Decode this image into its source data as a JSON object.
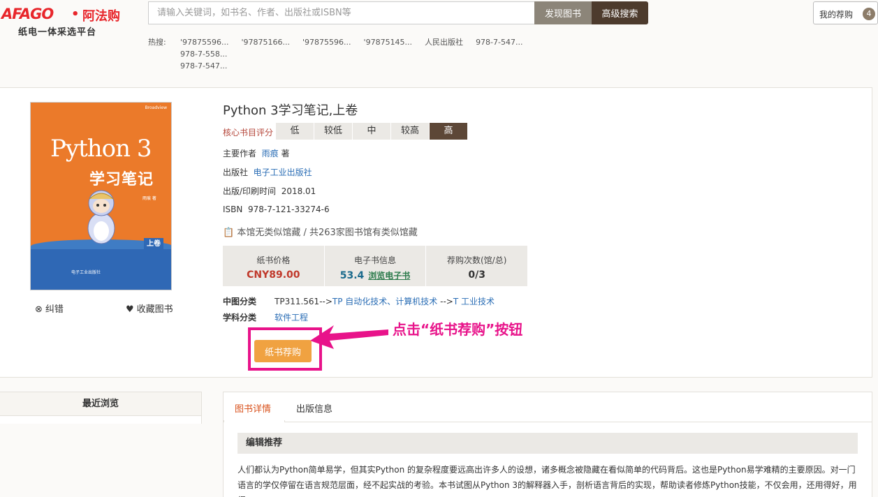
{
  "header": {
    "logo_mark": "AFAGO",
    "logo_name": "阿法购",
    "logo_slogan": "纸电一体采选平台",
    "search_placeholder": "请输入关键词，如书名、作者、出版社或ISBN等",
    "discover_label": "发现图书",
    "advanced_label": "高级搜索",
    "cart_label": "我的荐购",
    "cart_count": "4"
  },
  "hot_search": {
    "label": "热搜:",
    "items": [
      "'97875596...",
      "'97875166...",
      "'97875596...",
      "'97875145...",
      "人民出版社",
      "978-7-547...",
      "978-7-558...",
      "978-7-547..."
    ]
  },
  "book": {
    "title": "Python 3学习笔记,上卷",
    "score_label": "核心书目评分",
    "score_levels": [
      "低",
      "较低",
      "中",
      "较高",
      "高"
    ],
    "active_score": 4,
    "author_label": "主要作者",
    "author": "雨痕",
    "author_suffix": "著",
    "publisher_label": "出版社",
    "publisher": "电子工业出版社",
    "pubdate_label": "出版/印刷时间",
    "pubdate": "2018.01",
    "isbn_label": "ISBN",
    "isbn": "978-7-121-33274-6",
    "holdings": "本馆无类似馆藏 / 共263家图书馆有类似馆藏",
    "cover": {
      "title": "Python 3",
      "subtitle": "学习笔记",
      "volume": "上卷"
    }
  },
  "stats": {
    "paper_price_label": "纸书价格",
    "paper_price": "CNY89.00",
    "ebook_label": "电子书信息",
    "ebook_value": "53.4",
    "ebook_link": "浏览电子书",
    "recommend_label": "荐购次数(馆/总)",
    "recommend_value": "0/3"
  },
  "classification": {
    "clc_label": "中图分类",
    "clc_code": "TP311.561-->",
    "clc_path1": "TP 自动化技术、计算机技术",
    "clc_sep": "-->",
    "clc_path2": "T 工业技术",
    "subject_label": "学科分类",
    "subject": "软件工程"
  },
  "actions": {
    "correct": "纠错",
    "favorite": "收藏图书",
    "recommend_paper": "纸书荐购"
  },
  "annotation": {
    "callout": "点击“纸书荐购”按钮",
    "color": "#e8138a"
  },
  "recent": {
    "title": "最近浏览"
  },
  "details": {
    "tabs": [
      "图书详情",
      "出版信息"
    ],
    "section_title": "编辑推荐",
    "paragraph": "人们都认为Python简单易学，但其实Python 的复杂程度要远高出许多人的设想，诸多概念被隐藏在看似简单的代码背后。这也是Python易学难精的主要原因。对一门语言的学仅停留在语言规范层面，经不起实战的考验。本书试图从Python 3的解释器入手，剖析语言背后的实现，帮助读者修炼Python技能，不仅会用，还用得好，用得"
  }
}
